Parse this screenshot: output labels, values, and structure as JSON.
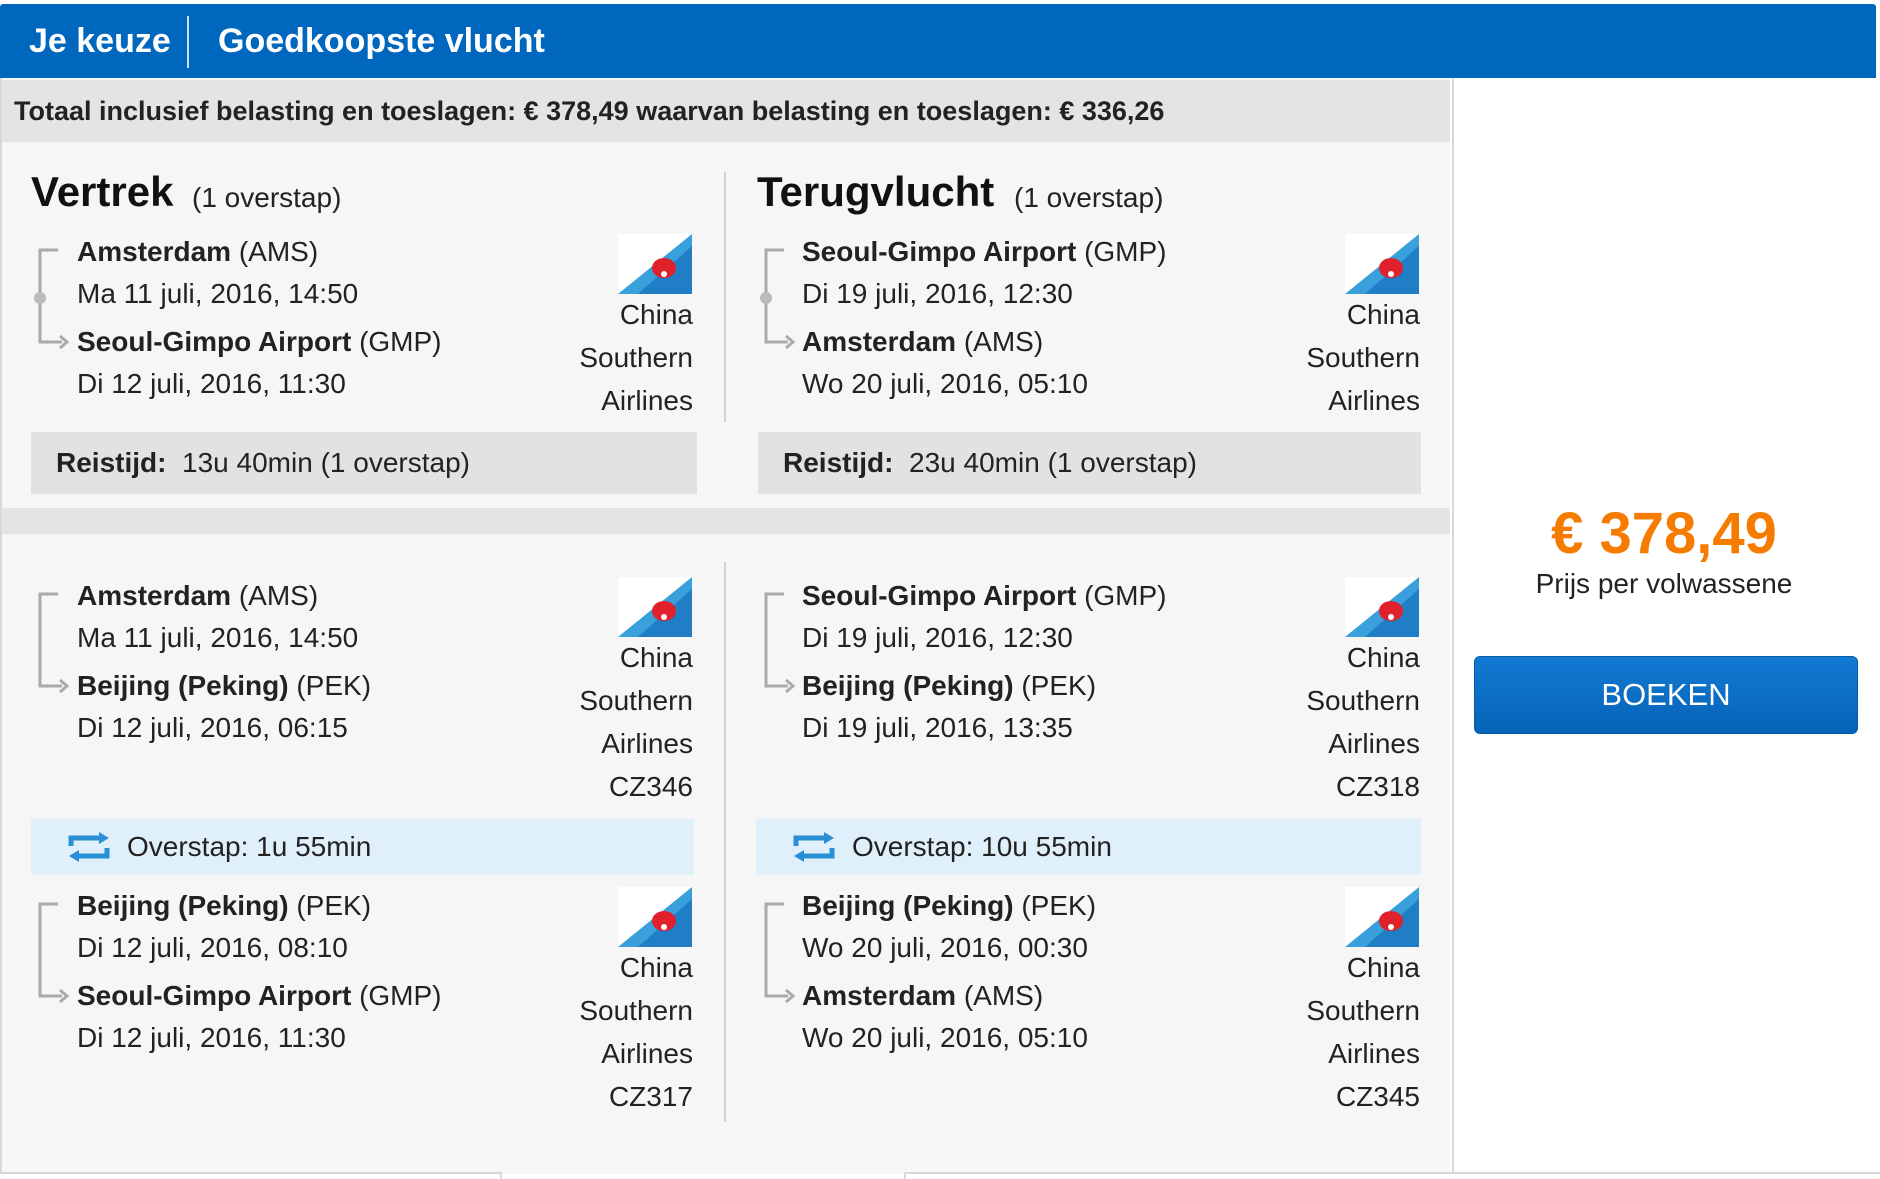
{
  "header": {
    "tab1": "Je keuze",
    "tab2": "Goedkoopste vlucht"
  },
  "total": "Totaal inclusief belasting en toeslagen: € 378,49 waarvan belasting en toeslagen: € 336,26",
  "outbound": {
    "title": "Vertrek",
    "stops": "(1 overstap)",
    "summary": {
      "from_name": "Amsterdam",
      "from_code": "(AMS)",
      "from_time": "Ma 11 juli, 2016, 14:50",
      "to_name": "Seoul-Gimpo Airport",
      "to_code": "(GMP)",
      "to_time": "Di 12 juli, 2016, 11:30",
      "airline1": "China",
      "airline2": "Southern",
      "airline3": "Airlines"
    },
    "duration_label": "Reistijd:",
    "duration_value": "13u 40min (1 overstap)",
    "seg1": {
      "from_name": "Amsterdam",
      "from_code": "(AMS)",
      "from_time": "Ma 11 juli, 2016, 14:50",
      "to_name": "Beijing (Peking)",
      "to_code": "(PEK)",
      "to_time": "Di 12 juli, 2016, 06:15",
      "airline1": "China",
      "airline2": "Southern",
      "airline3": "Airlines",
      "flight": "CZ346"
    },
    "transfer": "Overstap: 1u 55min",
    "seg2": {
      "from_name": "Beijing (Peking)",
      "from_code": "(PEK)",
      "from_time": "Di 12 juli, 2016, 08:10",
      "to_name": "Seoul-Gimpo Airport",
      "to_code": "(GMP)",
      "to_time": "Di 12 juli, 2016, 11:30",
      "airline1": "China",
      "airline2": "Southern",
      "airline3": "Airlines",
      "flight": "CZ317"
    }
  },
  "inbound": {
    "title": "Terugvlucht",
    "stops": "(1 overstap)",
    "summary": {
      "from_name": "Seoul-Gimpo Airport",
      "from_code": "(GMP)",
      "from_time": "Di 19 juli, 2016, 12:30",
      "to_name": "Amsterdam",
      "to_code": "(AMS)",
      "to_time": "Wo 20 juli, 2016, 05:10",
      "airline1": "China",
      "airline2": "Southern",
      "airline3": "Airlines"
    },
    "duration_label": "Reistijd:",
    "duration_value": "23u 40min (1 overstap)",
    "seg1": {
      "from_name": "Seoul-Gimpo Airport",
      "from_code": "(GMP)",
      "from_time": "Di 19 juli, 2016, 12:30",
      "to_name": "Beijing (Peking)",
      "to_code": "(PEK)",
      "to_time": "Di 19 juli, 2016, 13:35",
      "airline1": "China",
      "airline2": "Southern",
      "airline3": "Airlines",
      "flight": "CZ318"
    },
    "transfer": "Overstap: 10u 55min",
    "seg2": {
      "from_name": "Beijing (Peking)",
      "from_code": "(PEK)",
      "from_time": "Wo 20 juli, 2016, 00:30",
      "to_name": "Amsterdam",
      "to_code": "(AMS)",
      "to_time": "Wo 20 juli, 2016, 05:10",
      "airline1": "China",
      "airline2": "Southern",
      "airline3": "Airlines",
      "flight": "CZ345"
    }
  },
  "price": {
    "amount": "€ 378,49",
    "label": "Prijs per volwassene",
    "button": "BOEKEN"
  },
  "colors": {
    "brand_blue": "#0067be",
    "price_orange": "#f57c00",
    "transfer_bg": "#e0f0fb"
  }
}
